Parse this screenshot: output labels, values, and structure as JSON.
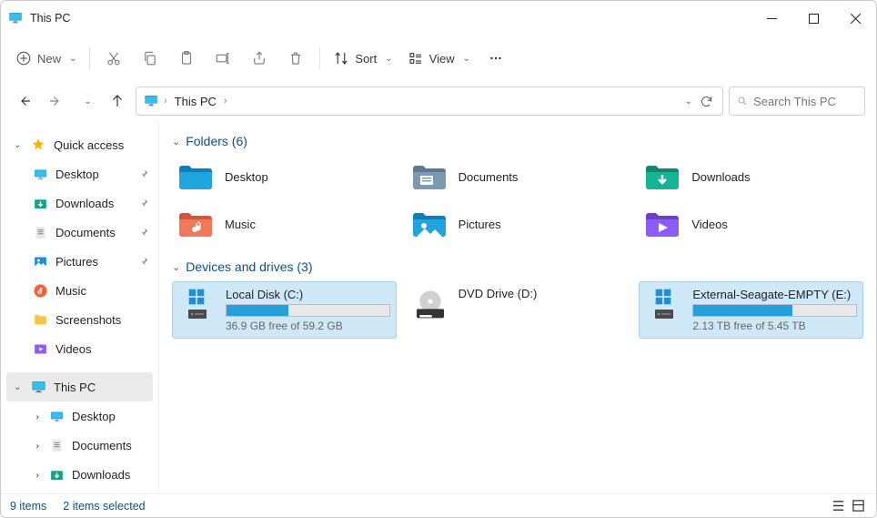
{
  "window": {
    "title": "This PC"
  },
  "toolbar": {
    "new": "New",
    "sort": "Sort",
    "view": "View"
  },
  "breadcrumb": {
    "root": "This PC"
  },
  "search": {
    "placeholder": "Search This PC"
  },
  "sidebar": {
    "quick_access": "Quick access",
    "items": [
      {
        "label": "Desktop"
      },
      {
        "label": "Downloads"
      },
      {
        "label": "Documents"
      },
      {
        "label": "Pictures"
      },
      {
        "label": "Music"
      },
      {
        "label": "Screenshots"
      },
      {
        "label": "Videos"
      }
    ],
    "this_pc": "This PC",
    "pc_items": [
      {
        "label": "Desktop"
      },
      {
        "label": "Documents"
      },
      {
        "label": "Downloads"
      }
    ]
  },
  "groups": {
    "folders_label": "Folders (6)",
    "drives_label": "Devices and drives (3)"
  },
  "folders": [
    {
      "name": "Desktop"
    },
    {
      "name": "Documents"
    },
    {
      "name": "Downloads"
    },
    {
      "name": "Music"
    },
    {
      "name": "Pictures"
    },
    {
      "name": "Videos"
    }
  ],
  "drives": [
    {
      "name": "Local Disk (C:)",
      "free_text": "36.9 GB free of 59.2 GB",
      "used_pct": 38,
      "selected": true,
      "type": "disk"
    },
    {
      "name": "DVD Drive (D:)",
      "free_text": "",
      "used_pct": 0,
      "selected": false,
      "type": "dvd"
    },
    {
      "name": "External-Seagate-EMPTY (E:)",
      "free_text": "2.13 TB free of 5.45 TB",
      "used_pct": 61,
      "selected": true,
      "type": "disk"
    }
  ],
  "status": {
    "items": "9 items",
    "selected": "2 items selected"
  }
}
